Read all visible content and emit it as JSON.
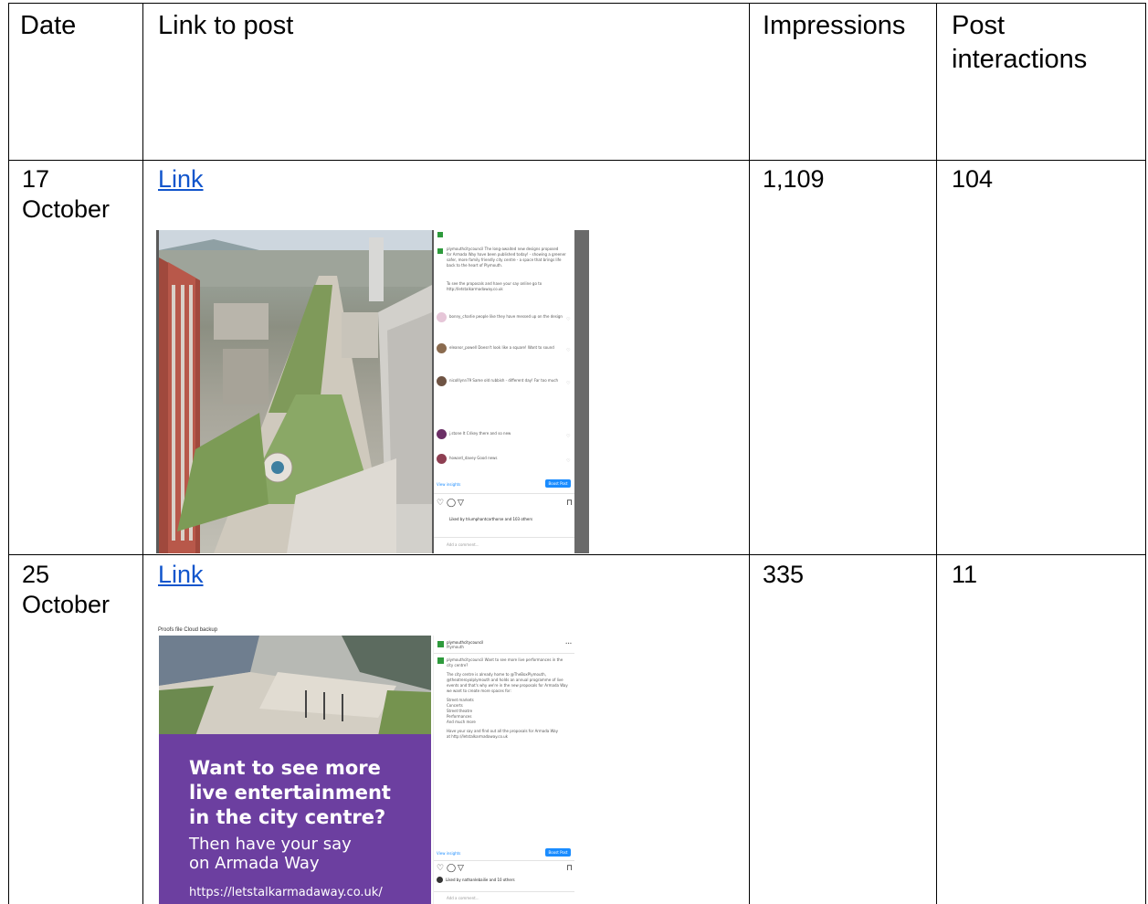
{
  "table": {
    "headers": [
      "Date",
      "Link to post",
      "Impressions",
      "Post interactions"
    ],
    "header_lines": {
      "interactions_1": "Post",
      "interactions_2": "interactions"
    },
    "rows": [
      {
        "date_line1": "17",
        "date_line2": "October",
        "link_label": "Link",
        "impressions": "1,109",
        "interactions": "104",
        "screenshot": {
          "caption_lines": [
            "plymouthcitycouncil The long-awaited new designs proposed",
            "for Armada Way have been published today! - showing a greener",
            "safer, more family friendly city centre - a space that brings life",
            "back to the heart of Plymouth.",
            "To see the proposals and have your say online go to",
            "http://letstalkarmadaway.co.uk"
          ],
          "comments": [
            "bonny_charlie people like they have messed up on the design",
            "eleanor_powell Doesn't look like a square! Want to sound",
            "nicolllynn79 Same old rubbish - different day! Far too much",
            "j.stone It Crikey there and so new",
            "howard_davey Good news"
          ],
          "view_insights": "View insights",
          "boost_post": "Boost Post",
          "liked_by": "Liked by triumphantcarthorse and 103 others",
          "add_comment": "Add a comment..."
        }
      },
      {
        "date_line1": "25",
        "date_line2": "October",
        "link_label": "Link",
        "impressions": "335",
        "interactions": "11",
        "screenshot": {
          "topbar": "Proofs file   Cloud backup",
          "account": "plymouthcitycouncil",
          "location": "Plymouth",
          "caption_lines": [
            "plymouthcitycouncil Want to see more live performances in the",
            "city centre?",
            "The city centre is already home to @TheBoxPlymouth,",
            "@theatreroyalplymouth and holds an annual programme of live",
            "events and that's why we're in the new proposals for Armada Way",
            "we want to create more spaces for:",
            "Street markets",
            "Concerts",
            "Street theatre",
            "Performances",
            "And much more",
            "Have your say and find out all the proposals for Armada Way",
            "at http://letstalkarmadaway.co.uk"
          ],
          "promo_heading": [
            "Want to see more",
            "live entertainment",
            "in the city centre?"
          ],
          "promo_sub": [
            "Then have your say",
            "on Armada Way"
          ],
          "promo_url": "https://letstalkarmadaway.co.uk/",
          "view_insights": "View insights",
          "boost_post": "Boost Post",
          "liked_by": "Liked by nathanlebailie and 10 others",
          "add_comment": "Add a comment..."
        }
      }
    ]
  },
  "colors": {
    "link": "#1155cc",
    "promo_purple": "#6c3fa0",
    "boost_blue": "#1a8cff"
  }
}
